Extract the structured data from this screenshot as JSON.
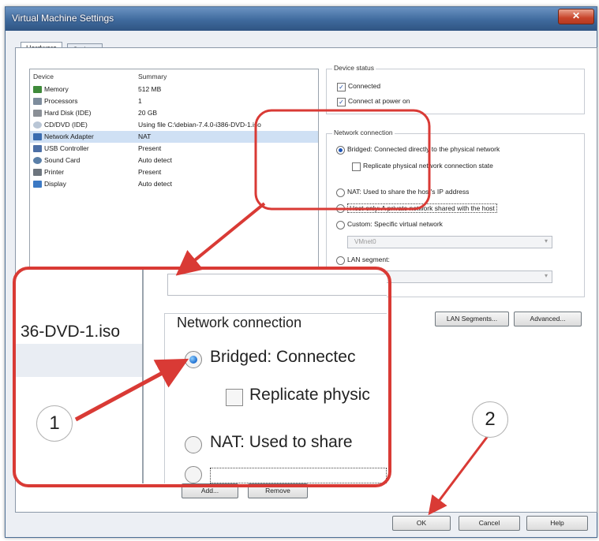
{
  "window": {
    "title": "Virtual Machine Settings",
    "close_glyph": "✕"
  },
  "tabs": [
    {
      "label": "Hardware"
    },
    {
      "label": "Options"
    }
  ],
  "device_list": {
    "headers": {
      "device": "Device",
      "summary": "Summary"
    },
    "rows": [
      {
        "device": "Memory",
        "summary": "512 MB",
        "icon": "memory-icon"
      },
      {
        "device": "Processors",
        "summary": "1",
        "icon": "processor-icon"
      },
      {
        "device": "Hard Disk (IDE)",
        "summary": "20 GB",
        "icon": "hard-disk-icon"
      },
      {
        "device": "CD/DVD (IDE)",
        "summary": "Using file C:\\debian-7.4.0-i386-DVD-1.iso",
        "icon": "cd-dvd-icon"
      },
      {
        "device": "Network Adapter",
        "summary": "NAT",
        "icon": "network-adapter-icon"
      },
      {
        "device": "USB Controller",
        "summary": "Present",
        "icon": "usb-controller-icon"
      },
      {
        "device": "Sound Card",
        "summary": "Auto detect",
        "icon": "sound-card-icon"
      },
      {
        "device": "Printer",
        "summary": "Present",
        "icon": "printer-icon"
      },
      {
        "device": "Display",
        "summary": "Auto detect",
        "icon": "display-icon"
      }
    ],
    "add_label": "Add...",
    "remove_label": "Remove"
  },
  "device_status": {
    "title": "Device status",
    "connected": "Connected",
    "connect_at_power_on": "Connect at power on"
  },
  "network_connection": {
    "title": "Network connection",
    "bridged": "Bridged: Connected directly to the physical network",
    "replicate": "Replicate physical network connection state",
    "nat": "NAT: Used to share the host's IP address",
    "host_only": "Host-only: A private network shared with the host",
    "custom": "Custom: Specific virtual network",
    "custom_value": "VMnet0",
    "lan_segment": "LAN segment:",
    "lan_segments_button": "LAN Segments...",
    "advanced_button": "Advanced..."
  },
  "zoom_callout": {
    "file_text": "36-DVD-1.iso",
    "title": "Network connection",
    "bridged": "Bridged: Connectec",
    "replicate": "Replicate physic",
    "nat": "NAT: Used to share"
  },
  "footer": {
    "ok": "OK",
    "cancel": "Cancel",
    "help": "Help"
  },
  "annotations": {
    "step1": "1",
    "step2": "2",
    "color": "#d93a35"
  },
  "colors": {
    "title_bar": "#3f6a9d",
    "selected_row": "#cfe0f4",
    "radio_selected": "#1e55b7"
  }
}
